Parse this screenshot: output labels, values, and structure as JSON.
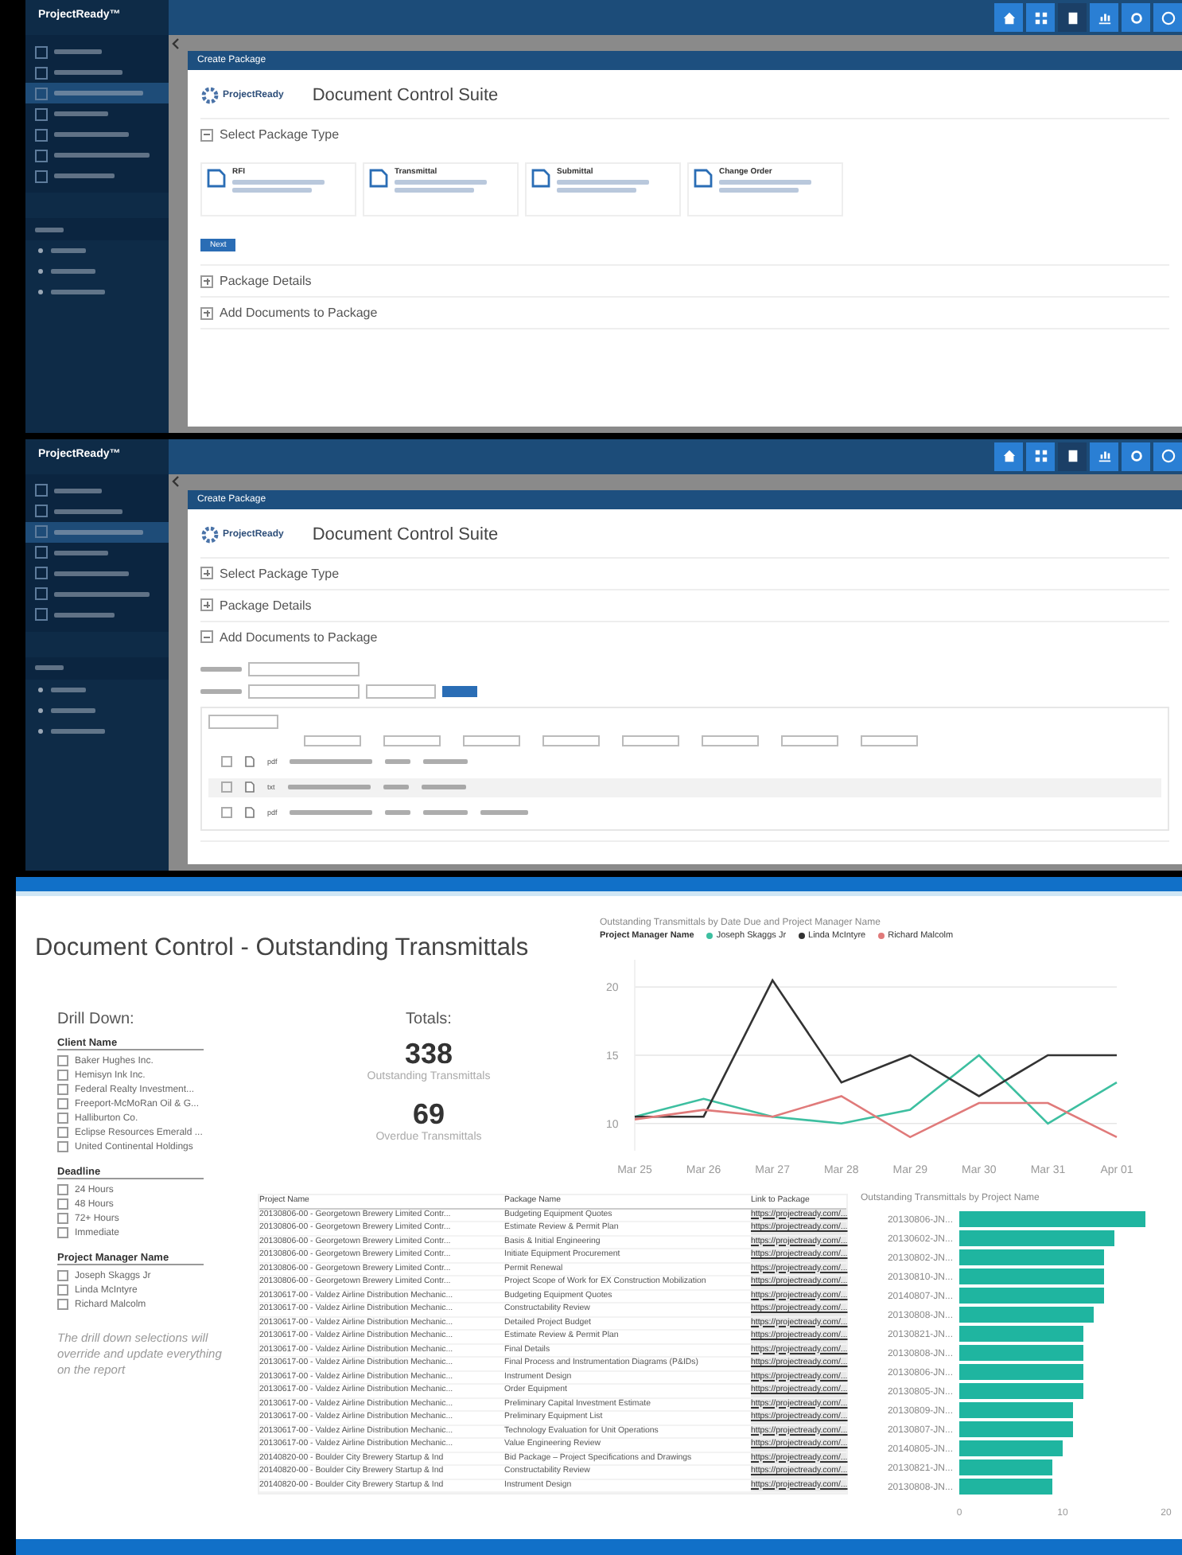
{
  "screens": [
    {
      "kind": "package_type",
      "brand": "ProjectReady™",
      "dialog_title": "Create Package",
      "logo_text": "ProjectReady",
      "suite_title": "Document Control Suite",
      "sections": [
        {
          "label": "Select Package Type",
          "expanded": true
        },
        {
          "label": "Package Details",
          "expanded": false
        },
        {
          "label": "Add Documents to Package",
          "expanded": false
        }
      ],
      "package_types": [
        {
          "label": "RFI"
        },
        {
          "label": "Transmittal"
        },
        {
          "label": "Submittal"
        },
        {
          "label": "Change Order"
        }
      ],
      "next_button": "Next",
      "sidebar": [
        {
          "selected": false
        },
        {
          "selected": false
        },
        {
          "selected": true
        },
        {
          "selected": false
        },
        {
          "selected": false
        },
        {
          "selected": false
        },
        {
          "selected": false
        }
      ]
    },
    {
      "kind": "documents",
      "brand": "ProjectReady™",
      "dialog_title": "Create Package",
      "logo_text": "ProjectReady",
      "suite_title": "Document Control Suite",
      "sections": [
        {
          "label": "Select Package Type",
          "expanded": false
        },
        {
          "label": "Package Details",
          "expanded": false
        },
        {
          "label": "Add Documents to Package",
          "expanded": true
        }
      ],
      "sidebar": [
        {
          "selected": false
        },
        {
          "selected": false
        },
        {
          "selected": true
        },
        {
          "selected": false
        },
        {
          "selected": false
        },
        {
          "selected": false
        },
        {
          "selected": false
        }
      ],
      "file_types": [
        {
          "label": "pdf",
          "checked": false
        },
        {
          "label": "txt",
          "checked": false
        },
        {
          "label": "pdf",
          "checked": false
        }
      ]
    }
  ],
  "dashboard": {
    "title": "Document Control - Outstanding Transmittals",
    "drill_heading": "Drill Down:",
    "totals_heading": "Totals:",
    "filters": [
      {
        "title": "Client Name",
        "items": [
          {
            "label": "Baker Hughes Inc.",
            "checked": false
          },
          {
            "label": "Hemisyn Ink Inc.",
            "checked": false
          },
          {
            "label": "Federal Realty Investment...",
            "checked": false
          },
          {
            "label": "Freeport-McMoRan Oil & G...",
            "checked": false
          },
          {
            "label": "Halliburton Co.",
            "checked": false
          },
          {
            "label": "Eclipse Resources Emerald ...",
            "checked": false
          },
          {
            "label": "United Continental Holdings",
            "checked": false
          }
        ]
      },
      {
        "title": "Deadline",
        "items": [
          {
            "label": "24 Hours",
            "checked": false
          },
          {
            "label": "48 Hours",
            "checked": false
          },
          {
            "label": "72+ Hours",
            "checked": false
          },
          {
            "label": "Immediate",
            "checked": false
          }
        ]
      },
      {
        "title": "Project Manager Name",
        "items": [
          {
            "label": "Joseph Skaggs Jr",
            "checked": false
          },
          {
            "label": "Linda McIntyre",
            "checked": false
          },
          {
            "label": "Richard Malcolm",
            "checked": false
          }
        ]
      }
    ],
    "note": "The drill down selections will override and update everything on the report",
    "totals": [
      {
        "value": "338",
        "label": "Outstanding Transmittals"
      },
      {
        "value": "69",
        "label": "Overdue Transmittals"
      }
    ],
    "line_chart": {
      "legend_title": "Project Manager Name",
      "chart_data": {
        "type": "line",
        "title": "Outstanding Transmittals by Date Due and Project Manager Name",
        "categories": [
          "Mar 25",
          "Mar 26",
          "Mar 27",
          "Mar 28",
          "Mar 29",
          "Mar 30",
          "Mar 31",
          "Apr 01"
        ],
        "ylim": [
          8,
          22
        ],
        "yticks": [
          10,
          15,
          20
        ],
        "grid": true,
        "legend": "top",
        "series": [
          {
            "name": "Joseph Skaggs Jr",
            "color": "#3dbfa0",
            "values": [
              10.5,
              11.8,
              10.5,
              10,
              11,
              15,
              10,
              13
            ]
          },
          {
            "name": "Linda McIntyre",
            "color": "#333333",
            "values": [
              10.5,
              10.5,
              20.5,
              13,
              15,
              12,
              15,
              15
            ]
          },
          {
            "name": "Richard Malcolm",
            "color": "#e07a7a",
            "values": [
              10.3,
              11,
              10.5,
              12,
              9,
              11.5,
              11.5,
              9
            ]
          }
        ]
      }
    },
    "table": {
      "columns": [
        "Project Name",
        "Package Name",
        "Link to Package"
      ],
      "rows": [
        [
          "20130806-00 - Georgetown Brewery Limited Contr...",
          "Budgeting Equipment Quotes",
          "https://projectready.com/..."
        ],
        [
          "20130806-00 - Georgetown Brewery Limited Contr...",
          "Estimate Review & Permit Plan",
          "https://projectready.com/..."
        ],
        [
          "20130806-00 - Georgetown Brewery Limited Contr...",
          "Basis & Initial Engineering",
          "https://projectready.com/..."
        ],
        [
          "20130806-00 - Georgetown Brewery Limited Contr...",
          "Initiate Equipment Procurement",
          "https://projectready.com/..."
        ],
        [
          "20130806-00 - Georgetown Brewery Limited Contr...",
          "Permit Renewal",
          "https://projectready.com/..."
        ],
        [
          "20130806-00 - Georgetown Brewery Limited Contr...",
          "Project Scope of Work for EX Construction Mobilization",
          "https://projectready.com/..."
        ],
        [
          "20130617-00 - Valdez Airline Distribution Mechanic...",
          "Budgeting Equipment Quotes",
          "https://projectready.com/..."
        ],
        [
          "20130617-00 - Valdez Airline Distribution Mechanic...",
          "Constructability Review",
          "https://projectready.com/..."
        ],
        [
          "20130617-00 - Valdez Airline Distribution Mechanic...",
          "Detailed Project Budget",
          "https://projectready.com/..."
        ],
        [
          "20130617-00 - Valdez Airline Distribution Mechanic...",
          "Estimate Review & Permit Plan",
          "https://projectready.com/..."
        ],
        [
          "20130617-00 - Valdez Airline Distribution Mechanic...",
          "Final Details",
          "https://projectready.com/..."
        ],
        [
          "20130617-00 - Valdez Airline Distribution Mechanic...",
          "Final Process and Instrumentation Diagrams (P&IDs)",
          "https://projectready.com/..."
        ],
        [
          "20130617-00 - Valdez Airline Distribution Mechanic...",
          "Instrument Design",
          "https://projectready.com/..."
        ],
        [
          "20130617-00 - Valdez Airline Distribution Mechanic...",
          "Order Equipment",
          "https://projectready.com/..."
        ],
        [
          "20130617-00 - Valdez Airline Distribution Mechanic...",
          "Preliminary Capital Investment Estimate",
          "https://projectready.com/..."
        ],
        [
          "20130617-00 - Valdez Airline Distribution Mechanic...",
          "Preliminary Equipment List",
          "https://projectready.com/..."
        ],
        [
          "20130617-00 - Valdez Airline Distribution Mechanic...",
          "Technology Evaluation for Unit Operations",
          "https://projectready.com/..."
        ],
        [
          "20130617-00 - Valdez Airline Distribution Mechanic...",
          "Value Engineering Review",
          "https://projectready.com/..."
        ],
        [
          "20140820-00 - Boulder City Brewery Startup & Ind",
          "Bid Package – Project Specifications and Drawings",
          "https://projectready.com/..."
        ],
        [
          "20140820-00 - Boulder City Brewery Startup & Ind",
          "Constructability Review",
          "https://projectready.com/..."
        ],
        [
          "20140820-00 - Boulder City Brewery Startup & Ind",
          "Instrument Design",
          "https://projectready.com/..."
        ]
      ]
    },
    "bar_chart": {
      "chart_data": {
        "type": "bar",
        "orientation": "horizontal",
        "title": "Outstanding Transmittals by Project Name",
        "categories": [
          "20130806-JN...",
          "20130602-JN...",
          "20130802-JN...",
          "20130810-JN...",
          "20140807-JN...",
          "20130808-JN...",
          "20130821-JN...",
          "20130808-JN...",
          "20130806-JN...",
          "20130805-JN...",
          "20130809-JN...",
          "20130807-JN...",
          "20140805-JN...",
          "20130821-JN...",
          "20130808-JN..."
        ],
        "xlim": [
          0,
          20
        ],
        "xticks": [
          0,
          10,
          20
        ],
        "values": [
          18,
          15,
          14,
          14,
          14,
          13,
          12,
          12,
          12,
          12,
          11,
          11,
          10,
          9,
          9
        ]
      }
    }
  }
}
